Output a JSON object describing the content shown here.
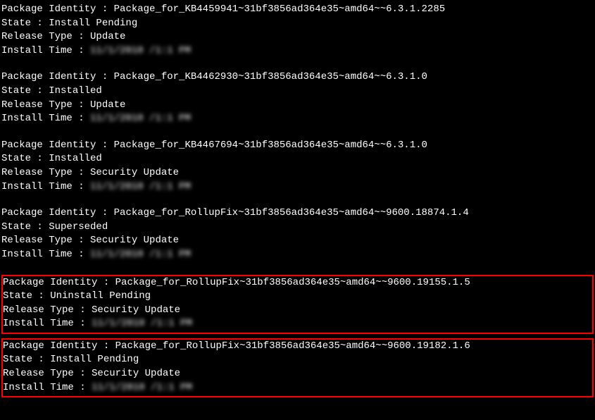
{
  "labels": {
    "package_identity": "Package Identity : ",
    "state": "State : ",
    "release_type": "Release Type : ",
    "install_time": "Install Time : "
  },
  "blurred_time": "11/1/2018 /1:1 PM",
  "packages": [
    {
      "identity": "Package_for_KB4459941~31bf3856ad364e35~amd64~~6.3.1.2285",
      "state": "Install Pending",
      "release_type": "Update",
      "highlighted": false
    },
    {
      "identity": "Package_for_KB4462930~31bf3856ad364e35~amd64~~6.3.1.0",
      "state": "Installed",
      "release_type": "Update",
      "highlighted": false
    },
    {
      "identity": "Package_for_KB4467694~31bf3856ad364e35~amd64~~6.3.1.0",
      "state": "Installed",
      "release_type": "Security Update",
      "highlighted": false
    },
    {
      "identity": "Package_for_RollupFix~31bf3856ad364e35~amd64~~9600.18874.1.4",
      "state": "Superseded",
      "release_type": "Security Update",
      "highlighted": false
    },
    {
      "identity": "Package_for_RollupFix~31bf3856ad364e35~amd64~~9600.19155.1.5",
      "state": "Uninstall Pending",
      "release_type": "Security Update",
      "highlighted": true
    },
    {
      "identity": "Package_for_RollupFix~31bf3856ad364e35~amd64~~9600.19182.1.6",
      "state": "Install Pending",
      "release_type": "Security Update",
      "highlighted": true
    }
  ]
}
